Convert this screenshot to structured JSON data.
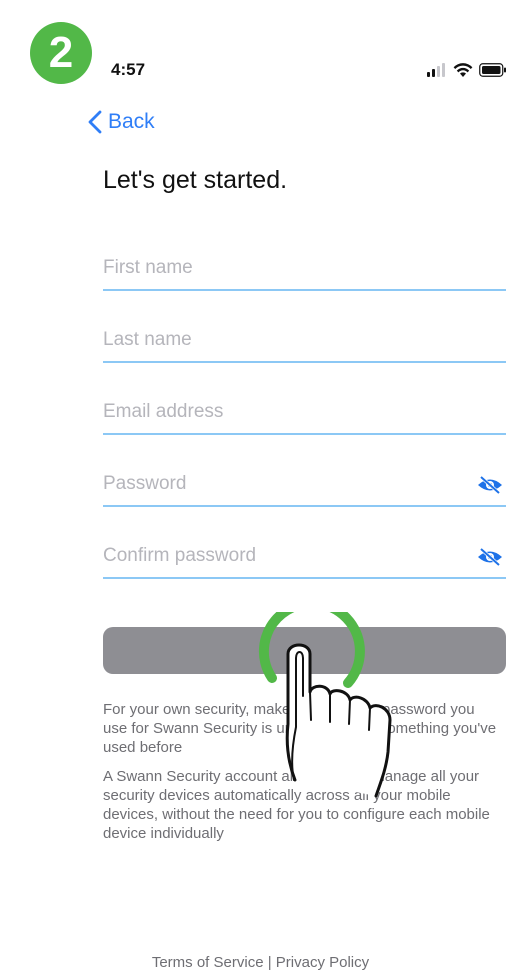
{
  "step_badge": "2",
  "status_bar": {
    "time": "4:57"
  },
  "nav": {
    "back_label": "Back"
  },
  "page": {
    "title": "Let's get started."
  },
  "form": {
    "first_name_placeholder": "First name",
    "last_name_placeholder": "Last name",
    "email_placeholder": "Email address",
    "password_placeholder": "Password",
    "confirm_password_placeholder": "Confirm password"
  },
  "info": {
    "paragraph1": "For your own security, make sure that the password you use for Swann Security is unique and not something you've used before",
    "paragraph2": "A Swann Security account allows you to manage all your security devices automatically across all your mobile devices, without the need for you to configure each mobile device individually"
  },
  "footer": {
    "terms": "Terms of Service",
    "separator": " | ",
    "privacy": "Privacy Policy"
  },
  "colors": {
    "accent": "#2f7ef7",
    "badge": "#52b848",
    "field_line": "#8cc8f5",
    "button": "#8e8e93"
  }
}
